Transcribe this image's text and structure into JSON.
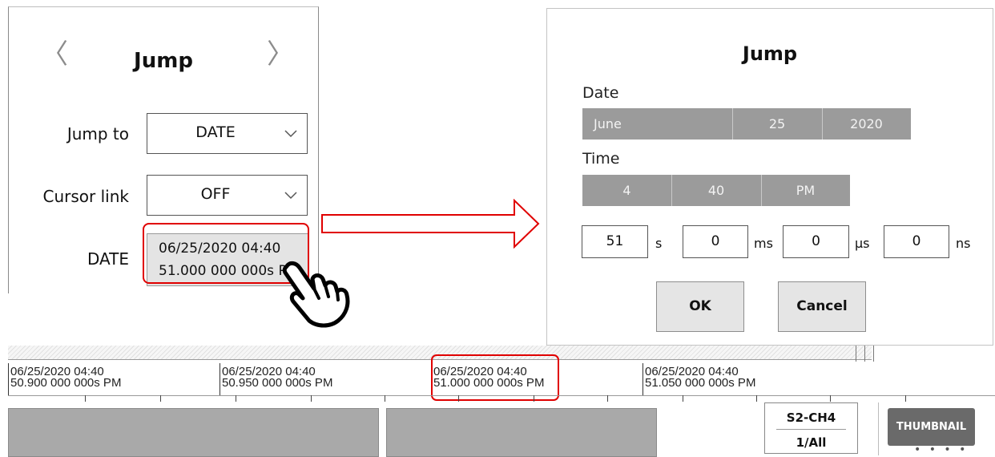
{
  "left_panel": {
    "title": "Jump",
    "prev_glyph": "〈",
    "next_glyph": "〉",
    "jump_to": {
      "label": "Jump to",
      "value": "DATE"
    },
    "cursor_link": {
      "label": "Cursor link",
      "value": "OFF"
    },
    "date": {
      "label": "DATE",
      "line1": "06/25/2020 04:40",
      "line2": "51.000 000 000s PM"
    }
  },
  "dialog": {
    "title": "Jump",
    "date_label": "Date",
    "date": {
      "month": "June",
      "day": "25",
      "year": "2020"
    },
    "time_label": "Time",
    "time": {
      "hour": "4",
      "minute": "40",
      "ampm": "PM"
    },
    "fields": [
      {
        "value": "51",
        "unit": "s"
      },
      {
        "value": "0",
        "unit": "ms"
      },
      {
        "value": "0",
        "unit": "µs"
      },
      {
        "value": "0",
        "unit": "ns"
      }
    ],
    "ok_label": "OK",
    "cancel_label": "Cancel"
  },
  "timeline": {
    "timestamps": [
      {
        "line1": "06/25/2020 04:40",
        "line2": "50.900 000 000s PM"
      },
      {
        "line1": "06/25/2020 04:40",
        "line2": "50.950 000 000s PM"
      },
      {
        "line1": "06/25/2020 04:40",
        "line2": "51.000 000 000s PM"
      },
      {
        "line1": "06/25/2020 04:40",
        "line2": "51.050 000 000s PM"
      }
    ],
    "channel": {
      "name": "S2-CH4",
      "page": "1/All"
    },
    "thumbnail_label": "THUMBNAIL",
    "thumbnail_dots": "• • • •"
  },
  "colors": {
    "highlight": "#e00000",
    "segment_bg": "#9b9b9b",
    "waveform": "#a9a9a9",
    "thumbnail_bg": "#6a6a6a"
  },
  "icons": [
    "chevron-left-icon",
    "chevron-right-icon",
    "chevron-down-icon",
    "right-arrow-icon",
    "pointing-hand-icon"
  ]
}
